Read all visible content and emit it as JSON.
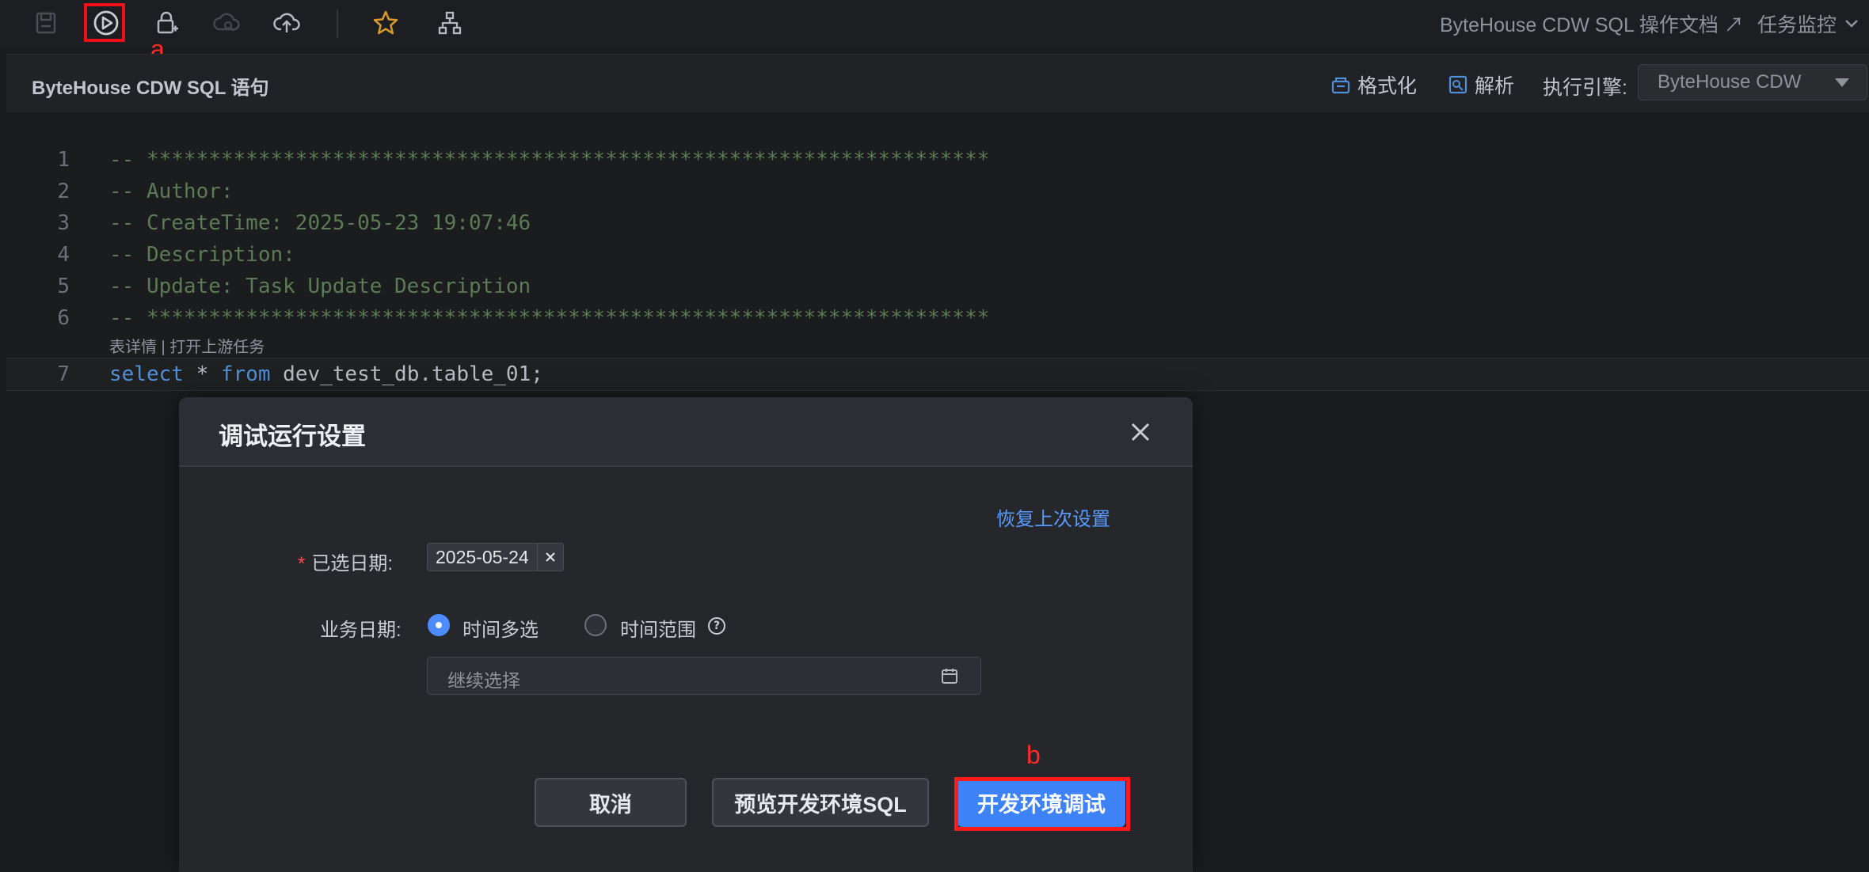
{
  "toolbar": {
    "icons": [
      "save-icon",
      "run-icon",
      "lock-add-icon",
      "cloud-search-icon",
      "cloud-upload-icon",
      "star-icon",
      "lineage-icon"
    ],
    "annotation_a": "a",
    "doc_link": "ByteHouse CDW SQL 操作文档 ↗",
    "monitor_link": "任务监控"
  },
  "editor": {
    "title": "ByteHouse CDW SQL 语句",
    "format_label": "格式化",
    "parse_label": "解析",
    "engine_label": "执行引擎:",
    "engine_value": "ByteHouse CDW",
    "lines": [
      {
        "num": "1",
        "text": "-- ********************************************************************"
      },
      {
        "num": "2",
        "text": "-- Author:"
      },
      {
        "num": "3",
        "text": "-- CreateTime: 2025-05-23 19:07:46"
      },
      {
        "num": "4",
        "text": "-- Description:"
      },
      {
        "num": "5",
        "text": "-- Update: Task Update Description"
      },
      {
        "num": "6",
        "text": "-- ********************************************************************"
      },
      {
        "num": "7",
        "kw1": "select",
        "star": " * ",
        "kw2": "from",
        "rest": " dev_test_db.table_01;"
      }
    ],
    "codelens": "表详情 | 打开上游任务"
  },
  "modal": {
    "title": "调试运行设置",
    "restore_link": "恢复上次设置",
    "required_mark": "*",
    "selected_date_label": "已选日期:",
    "selected_date_tag": "2025-05-24",
    "biz_date_label": "业务日期:",
    "radio_multi": "时间多选",
    "radio_range": "时间范围",
    "help_glyph": "?",
    "date_placeholder": "继续选择",
    "cancel_button": "取消",
    "preview_button": "预览开发环境SQL",
    "debug_button": "开发环境调试",
    "annotation_b": "b"
  },
  "colors": {
    "accent": "#3d82f7",
    "link": "#5a9bff",
    "annotation": "#ff1a1a",
    "star": "#d99a2b"
  }
}
